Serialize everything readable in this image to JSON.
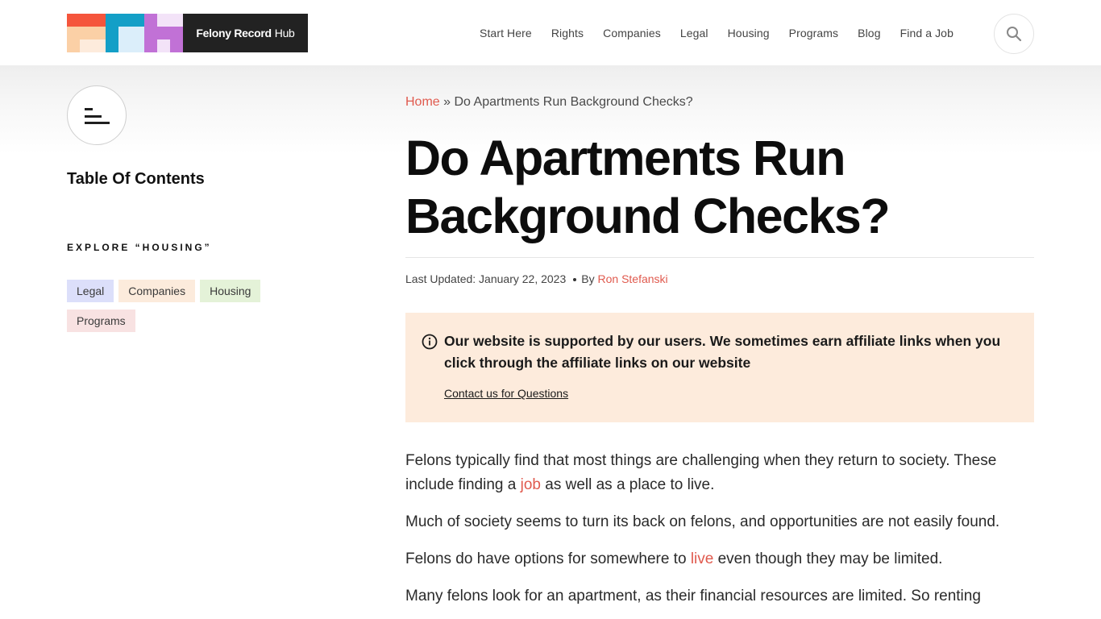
{
  "header": {
    "logo": {
      "bold": "Felony Record",
      "light": "Hub"
    },
    "nav": [
      "Start Here",
      "Rights",
      "Companies",
      "Legal",
      "Housing",
      "Programs",
      "Blog",
      "Find a Job"
    ],
    "search_icon": "search-icon"
  },
  "sidebar": {
    "toc_icon": "toc-menu-icon",
    "toc_title": "Table Of Contents",
    "explore_label": "EXPLORE “HOUSING”",
    "tags": [
      {
        "label": "Legal",
        "color": "#dcdffa"
      },
      {
        "label": "Companies",
        "color": "#fcebdc"
      },
      {
        "label": "Housing",
        "color": "#e4f2d8"
      },
      {
        "label": "Programs",
        "color": "#f8e2e2"
      }
    ]
  },
  "article": {
    "breadcrumb": {
      "home": "Home",
      "sep": "»",
      "current": "Do Apartments Run Background Checks?"
    },
    "title": "Do Apartments Run Background Checks?",
    "meta": {
      "updated": "Last Updated: January 22, 2023",
      "by": "By",
      "author": "Ron Stefanski"
    },
    "notice": {
      "icon": "info-icon",
      "text": "Our website is supported by our users. We sometimes earn affiliate links when you click through the affiliate links on our website",
      "link": "Contact us for Questions"
    },
    "paragraphs": {
      "p1_before": "Felons typically find that most things are challenging when they return to society. These include finding a ",
      "p1_link": "job",
      "p1_after": " as well as a place to live.",
      "p2": "Much of society seems to turn its back on felons, and opportunities are not easily found.",
      "p3_before": "Felons do have options for somewhere to ",
      "p3_link": "live",
      "p3_after": " even though they may be limited.",
      "p4": "Many felons look for an apartment, as their financial resources are limited. So renting"
    }
  },
  "colors": {
    "accent": "#e05a4e",
    "notice_bg": "#fdebdc",
    "logo_dark": "#222222"
  }
}
